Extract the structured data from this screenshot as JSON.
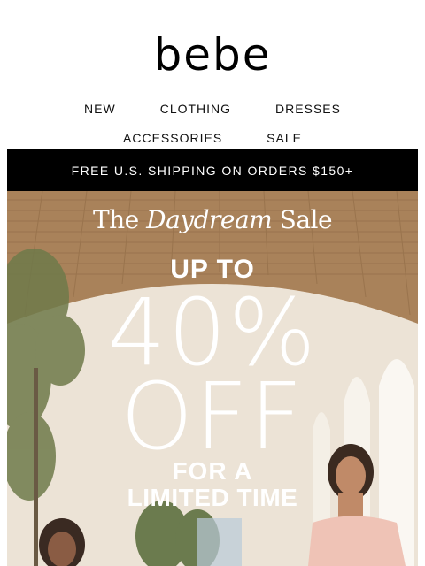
{
  "header": {
    "logo_text": "bebe"
  },
  "nav": {
    "row1": [
      "NEW",
      "CLOTHING",
      "DRESSES"
    ],
    "row2": [
      "ACCESSORIES",
      "SALE"
    ]
  },
  "promo_bar": {
    "text": "FREE U.S. SHIPPING ON ORDERS $150+"
  },
  "hero": {
    "title_the": "The",
    "title_daydream": "Daydream",
    "title_sale": "Sale",
    "up_to": "UP TO",
    "percent": "40%",
    "off": "OFF",
    "for_a": "FOR A",
    "limited_time": "LIMITED TIME"
  },
  "colors": {
    "promo_bg": "#000000",
    "promo_text": "#ffffff",
    "hero_text": "#ffffff"
  }
}
